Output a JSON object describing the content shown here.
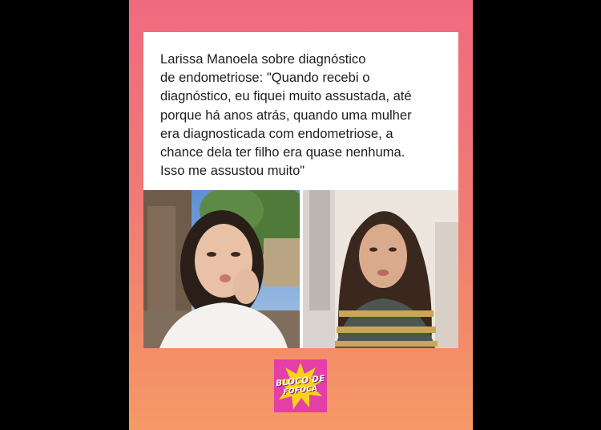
{
  "post": {
    "caption": "Larissa Manoela sobre diagnóstico\nde endometriose: \"Quando recebi o\ndiagnóstico, eu fiquei muito assustada, até\nporque há anos atrás, quando uma mulher\nera diagnosticada com endometriose, a\nchance dela ter filho era quase nenhuma.\nIsso me assustou muito\""
  },
  "logo": {
    "line1": "BLOCO DE",
    "line2": "FOFOCA"
  },
  "colors": {
    "background_top": "#f06a7f",
    "background_bottom": "#f59a66",
    "card": "#ffffff",
    "logo_bg": "#e33fa7",
    "logo_burst": "#f7d21a"
  }
}
